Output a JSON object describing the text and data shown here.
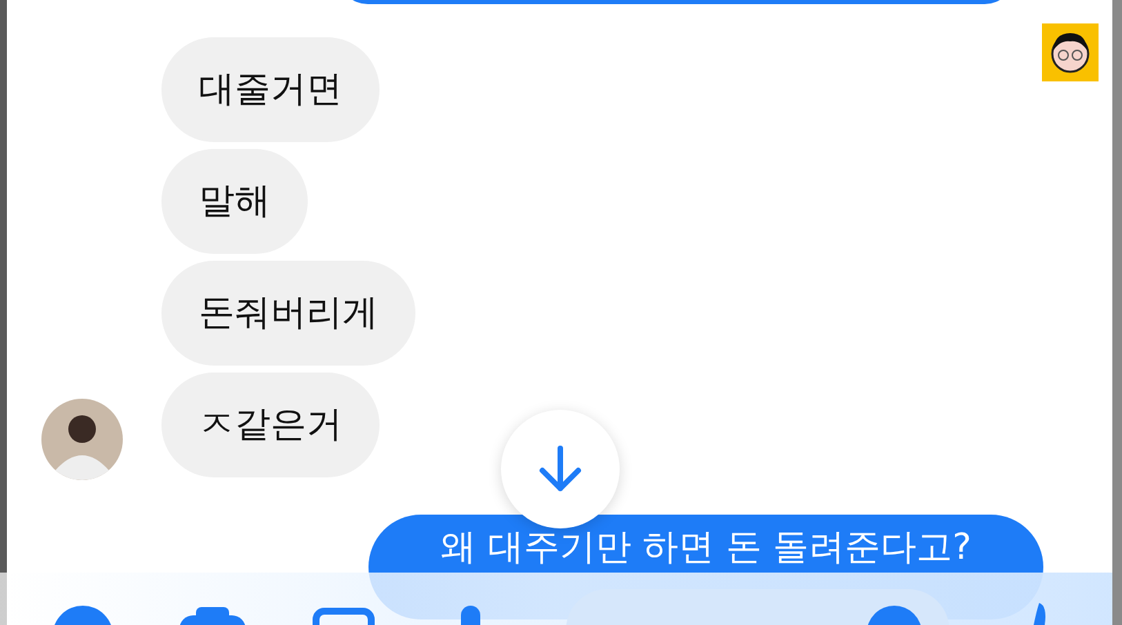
{
  "incoming_messages": [
    {
      "text": "대줄거면"
    },
    {
      "text": "말해"
    },
    {
      "text": "돈줘버리게"
    },
    {
      "text": "ㅈ같은거"
    }
  ],
  "outgoing_message": {
    "text": "왜 대주기만 하면 돈 돌려준다고?"
  }
}
